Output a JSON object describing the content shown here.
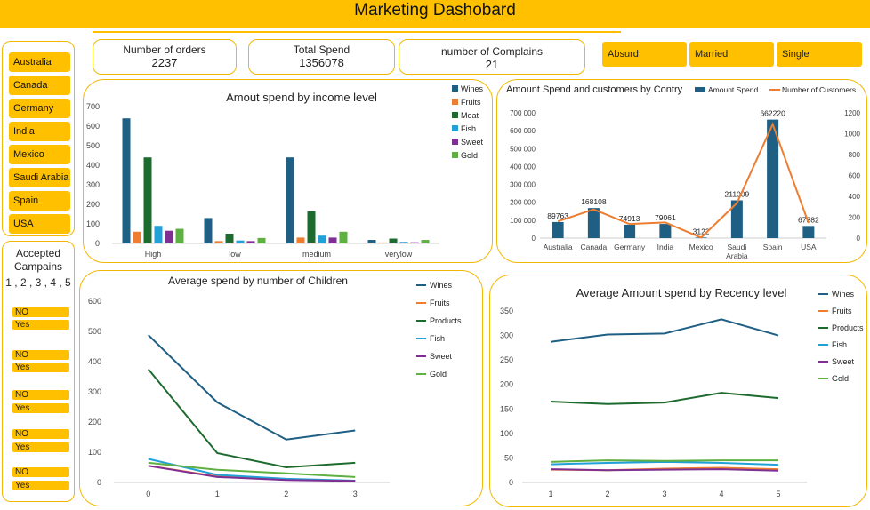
{
  "title": "Marketing Dashobard",
  "countries_slicer": [
    "Australia",
    "Canada",
    "Germany",
    "India",
    "Mexico",
    "Saudi Arabia",
    "Spain",
    "USA"
  ],
  "kpis": [
    {
      "label": "Number of orders",
      "value": "2237"
    },
    {
      "label": "Total Spend",
      "value": "1356078"
    },
    {
      "label": "number of Complains",
      "value": "21"
    }
  ],
  "marital_slicer": [
    "Absurd",
    "Married",
    "Single"
  ],
  "accepted": {
    "title_line1": "Accepted",
    "title_line2": "Campains",
    "numbers": "1 , 2 , 3 , 4 , 5",
    "groups": [
      [
        "NO",
        "Yes"
      ],
      [
        "NO",
        "Yes"
      ],
      [
        "NO",
        "Yes"
      ],
      [
        "NO",
        "Yes"
      ],
      [
        "NO",
        "Yes"
      ]
    ]
  },
  "colors": {
    "accent": "#ffc000",
    "Wines": "#1f5f84",
    "Fruits": "#ed7d31",
    "Meat": "#1e6b30",
    "Products": "#1e6b30",
    "Fish": "#22a1d8",
    "Sweet": "#7e2f91",
    "Gold": "#5fb043",
    "Amount Spend": "#1f5f84",
    "Number of Customers": "#ed7d31"
  },
  "chart_data": [
    {
      "type": "bar",
      "title": "Amout spend by income level",
      "categories": [
        "High",
        "low",
        "medium",
        "verylow"
      ],
      "ylim": [
        0,
        700
      ],
      "yticks": [
        0,
        100,
        200,
        300,
        400,
        500,
        600,
        700
      ],
      "series": [
        {
          "name": "Wines",
          "values": [
            640,
            130,
            440,
            18
          ]
        },
        {
          "name": "Fruits",
          "values": [
            60,
            12,
            30,
            5
          ]
        },
        {
          "name": "Meat",
          "values": [
            440,
            50,
            165,
            25
          ]
        },
        {
          "name": "Fish",
          "values": [
            90,
            15,
            40,
            8
          ]
        },
        {
          "name": "Sweet",
          "values": [
            65,
            12,
            30,
            6
          ]
        },
        {
          "name": "Gold",
          "values": [
            75,
            28,
            60,
            18
          ]
        }
      ],
      "legend": "right"
    },
    {
      "type": "bar",
      "title": "Amount Spend and customers by Contry",
      "categories": [
        "Australia",
        "Canada",
        "Germany",
        "India",
        "Mexico",
        "Saudi Arabia",
        "Spain",
        "USA"
      ],
      "ylim": [
        0,
        700000
      ],
      "yticks": [
        0,
        100000,
        200000,
        300000,
        400000,
        500000,
        600000,
        700000
      ],
      "y2lim": [
        0,
        1200
      ],
      "y2ticks": [
        0,
        200,
        400,
        600,
        800,
        1000,
        1200
      ],
      "series": [
        {
          "name": "Amount Spend",
          "type": "bar",
          "values": [
            89763,
            168108,
            74913,
            79061,
            3122,
            211009,
            662220,
            67882
          ]
        },
        {
          "name": "Number of Customers",
          "type": "line",
          "axis": "secondary",
          "values": [
            160,
            275,
            135,
            150,
            5,
            335,
            1090,
            145
          ]
        }
      ],
      "legend": "top"
    },
    {
      "type": "line",
      "title": "Average spend by number of Children",
      "x": [
        0,
        1,
        2,
        3
      ],
      "ylim": [
        0,
        600
      ],
      "yticks": [
        0,
        100,
        200,
        300,
        400,
        500,
        600
      ],
      "series": [
        {
          "name": "Wines",
          "values": [
            488,
            265,
            142,
            172
          ]
        },
        {
          "name": "Fruits",
          "values": [
            55,
            20,
            10,
            5
          ]
        },
        {
          "name": "Products",
          "values": [
            375,
            97,
            50,
            65
          ]
        },
        {
          "name": "Fish",
          "values": [
            78,
            25,
            12,
            6
          ]
        },
        {
          "name": "Sweet",
          "values": [
            55,
            18,
            8,
            5
          ]
        },
        {
          "name": "Gold",
          "values": [
            65,
            42,
            30,
            18
          ]
        }
      ],
      "legend": "right"
    },
    {
      "type": "line",
      "title": "Average Amount spend by Recency level",
      "x": [
        1,
        2,
        3,
        4,
        5
      ],
      "ylim": [
        0,
        350
      ],
      "yticks": [
        0,
        50,
        100,
        150,
        200,
        250,
        300,
        350
      ],
      "series": [
        {
          "name": "Wines",
          "values": [
            287,
            302,
            304,
            333,
            300
          ]
        },
        {
          "name": "Fruits",
          "values": [
            26,
            25,
            28,
            30,
            27
          ]
        },
        {
          "name": "Products",
          "values": [
            165,
            160,
            163,
            183,
            172
          ]
        },
        {
          "name": "Fish",
          "values": [
            37,
            40,
            42,
            40,
            36
          ]
        },
        {
          "name": "Sweet",
          "values": [
            27,
            25,
            26,
            27,
            24
          ]
        },
        {
          "name": "Gold",
          "values": [
            42,
            45,
            44,
            45,
            45
          ]
        }
      ],
      "legend": "right"
    }
  ]
}
